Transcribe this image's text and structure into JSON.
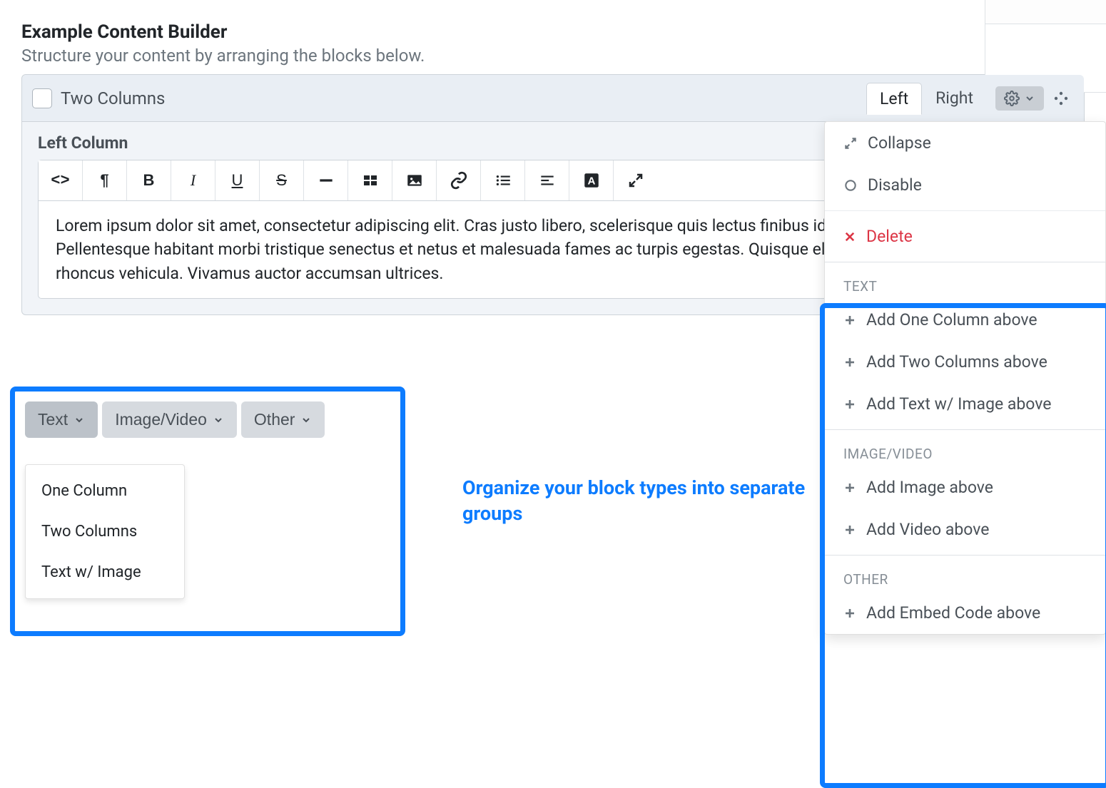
{
  "header": {
    "title": "Example Content Builder",
    "subtitle": "Structure your content by arranging the blocks below."
  },
  "block": {
    "label": "Two Columns",
    "tabs": [
      {
        "label": "Left",
        "active": true
      },
      {
        "label": "Right",
        "active": false
      }
    ],
    "section_title": "Left Column",
    "content": "Lorem ipsum dolor sit amet, consectetur adipiscing elit. Cras justo libero, scelerisque quis lectus finibus id, semper eget mauris. Pellentesque habitant morbi tristique senectus et netus et malesuada fames ac turpis egestas. Quisque elementum justo iaculis sapien rhoncus vehicula. Vivamus auctor accumsan ultrices."
  },
  "group_chips": [
    {
      "label": "Text",
      "active": true
    },
    {
      "label": "Image/Video",
      "active": false
    },
    {
      "label": "Other",
      "active": false
    }
  ],
  "group_dropdown": [
    "One Column",
    "Two Columns",
    "Text w/ Image"
  ],
  "callout": "Organize your block types into separate groups",
  "gear_menu": {
    "top": [
      {
        "label": "Collapse",
        "icon": "collapse-icon"
      },
      {
        "label": "Disable",
        "icon": "circle-icon"
      },
      {
        "label": "Delete",
        "icon": "x-icon",
        "danger": true
      }
    ],
    "groups": [
      {
        "name": "TEXT",
        "items": [
          "Add One Column above",
          "Add Two Columns above",
          "Add Text w/ Image above"
        ]
      },
      {
        "name": "IMAGE/VIDEO",
        "items": [
          "Add Image above",
          "Add Video above"
        ]
      },
      {
        "name": "OTHER",
        "items": [
          "Add Embed Code above"
        ]
      }
    ]
  }
}
